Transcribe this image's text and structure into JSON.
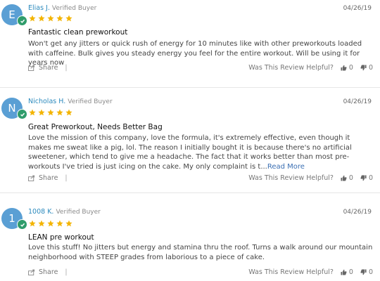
{
  "theme": {
    "accent": "#2b8abd",
    "avatar_bg": "#5a9fd4",
    "check_bg": "#2f9c6b",
    "star": "#f3b400"
  },
  "reviews": [
    {
      "initial": "E",
      "name": "Elias J.",
      "verified": "Verified Buyer",
      "date": "04/26/19",
      "rating": 5,
      "title": "Fantastic clean preworkout",
      "body": "Won't get any jitters or quick rush of energy for 10 minutes like with other preworkouts loaded with caffeine. Bulk gives you steady energy you feel for the entire workout. Will be using it for years now",
      "read_more": "",
      "share": "Share",
      "helpful_label": "Was This Review Helpful?",
      "up": "0",
      "down": "0"
    },
    {
      "initial": "N",
      "name": "Nicholas H.",
      "verified": "Verified Buyer",
      "date": "04/26/19",
      "rating": 5,
      "title": "Great Preworkout, Needs Better Bag",
      "body": "Love the mission of this company, love the formula, it's extremely effective, even though it makes me sweat like a pig, lol. The reason I initially bought it is because there's no artificial sweetener, which tend to give me a headache. The fact that it works better than most pre-workouts I've tried is just icing on the cake. My only complaint is t...",
      "read_more": "Read More",
      "share": "Share",
      "helpful_label": "Was This Review Helpful?",
      "up": "0",
      "down": "0"
    },
    {
      "initial": "1",
      "name": "1008 K.",
      "verified": "Verified Buyer",
      "date": "04/26/19",
      "rating": 5,
      "title": "LEAN pre workout",
      "body": "Love this stuff! No jitters but energy and stamina thru the roof. Turns a walk around our mountain neighborhood with STEEP grades from laborious to a piece of cake.",
      "read_more": "",
      "share": "Share",
      "helpful_label": "Was This Review Helpful?",
      "up": "0",
      "down": "0"
    }
  ]
}
